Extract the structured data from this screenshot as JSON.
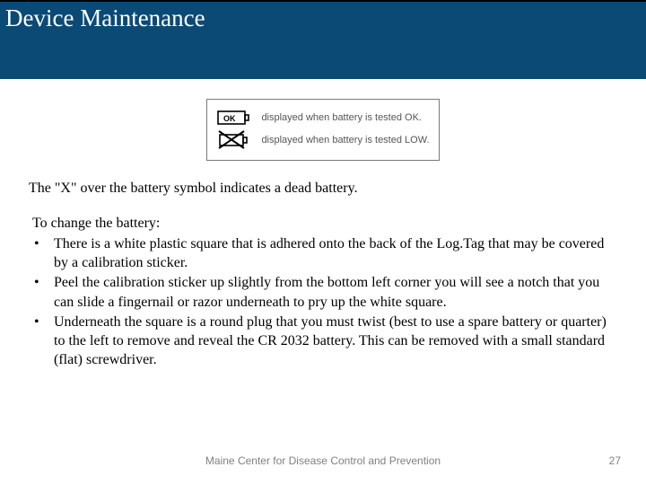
{
  "header": {
    "title": "Device Maintenance"
  },
  "diagram": {
    "rows": [
      {
        "icon": "battery-ok-icon",
        "text": "displayed when battery is tested OK."
      },
      {
        "icon": "battery-low-icon",
        "text": "displayed when battery is tested LOW."
      }
    ]
  },
  "body": {
    "lead": "The \"X\" over the battery symbol indicates a dead battery.",
    "change_title": "To change the battery:",
    "steps": [
      "There is a white plastic square that is adhered onto the back of the Log.Tag that may be covered by a calibration sticker.",
      "Peel the calibration sticker up slightly from the bottom left corner you will see a notch that you can slide a fingernail or razor underneath to pry up the white square.",
      "Underneath the square is a round plug that you must twist (best to use a spare battery or quarter) to the left to remove and reveal the CR 2032 battery. This can be removed with a small standard (flat) screwdriver."
    ]
  },
  "footer": {
    "org": "Maine Center for Disease Control and Prevention",
    "page": "27"
  }
}
